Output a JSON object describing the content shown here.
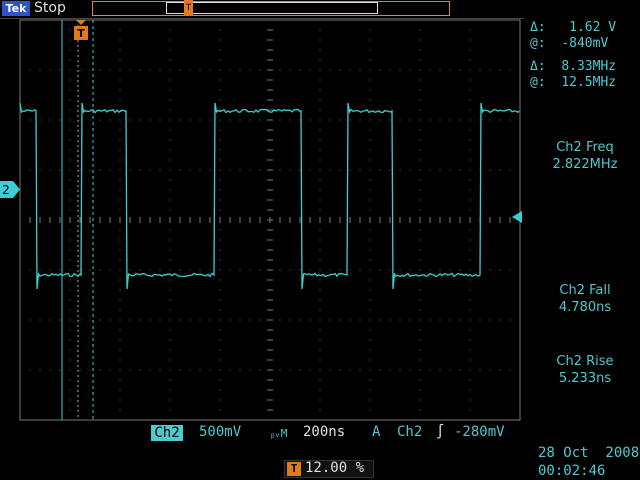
{
  "header": {
    "logo": "Tek",
    "status": "Stop"
  },
  "cursors": {
    "delta_v_symbol": "Δ:",
    "delta_v": "1.62 V",
    "at_v_symbol": "@:",
    "at_v": "-840mV",
    "delta_f_symbol": "Δ:",
    "delta_f": "8.33MHz",
    "at_f_symbol": "@:",
    "at_f": "12.5MHz"
  },
  "measurements": [
    {
      "label": "Ch2 Freq",
      "value": "2.822MHz"
    },
    {
      "label": "Ch2 Fall",
      "value": "4.780ns"
    },
    {
      "label": "Ch2 Rise",
      "value": "5.233ns"
    }
  ],
  "bottom_bar": {
    "channel": "Ch2",
    "volts_div": "500mV",
    "bw_symbol": "ᵦᵥM",
    "time_div": "200ns",
    "trigger_mode": "A",
    "trigger_source": "Ch2",
    "trigger_slope": "∫",
    "trigger_level": "-280mV"
  },
  "trigger_position": "12.00 %",
  "datetime": {
    "date": "28 Oct  2008",
    "time": "00:02:46"
  },
  "markers": {
    "channel_marker": "2",
    "trigger_marker": "T"
  },
  "colors": {
    "trace": "#3ccfd2",
    "graticule": "#7a7a7a",
    "trigger_accent": "#e07a1a"
  }
}
